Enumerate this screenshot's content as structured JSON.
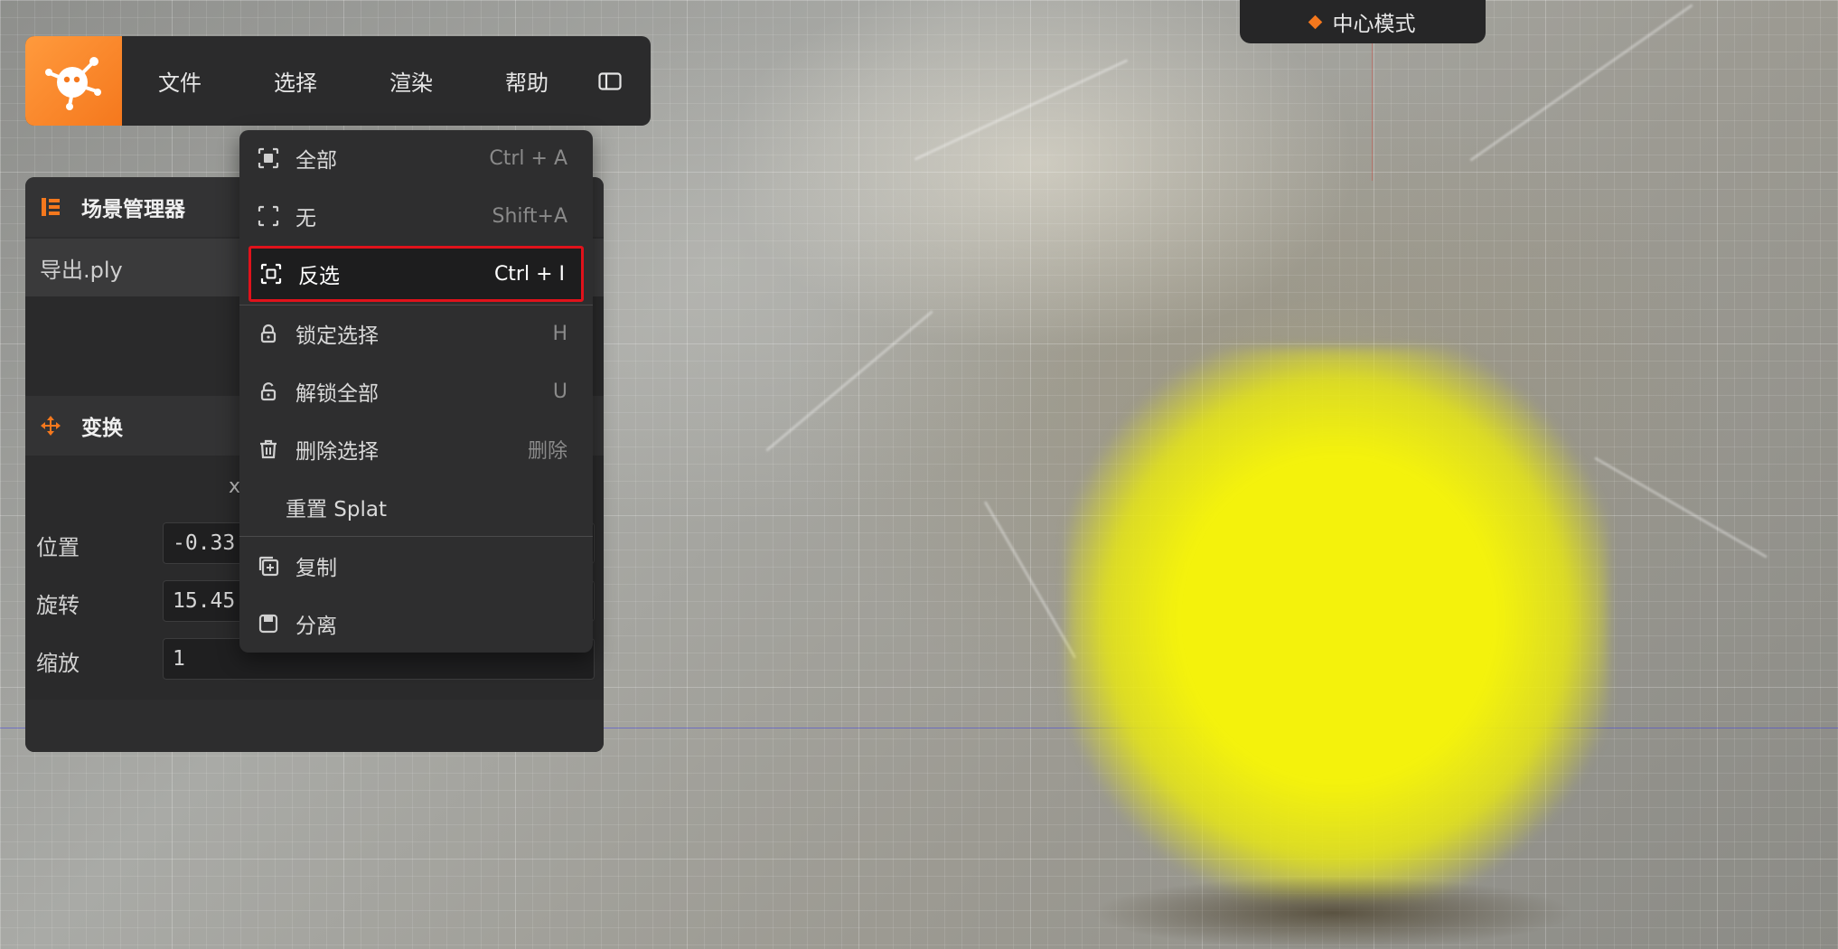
{
  "menubar": {
    "items": [
      "文件",
      "选择",
      "渲染",
      "帮助"
    ]
  },
  "mode_pill": {
    "label": "中心模式",
    "accent": "#f5781d"
  },
  "scene_manager": {
    "title": "场景管理器",
    "items": [
      "导出.ply"
    ]
  },
  "transform": {
    "title": "变换",
    "axis_label": "x",
    "properties": [
      {
        "label": "位置",
        "value": "-0.33"
      },
      {
        "label": "旋转",
        "value": "15.45"
      },
      {
        "label": "缩放",
        "value": "1"
      }
    ]
  },
  "select_menu": {
    "items": [
      {
        "label": "全部",
        "shortcut": "Ctrl + A",
        "icon": "select-all-icon"
      },
      {
        "label": "无",
        "shortcut": "Shift+A",
        "icon": "select-none-icon"
      },
      {
        "label": "反选",
        "shortcut": "Ctrl + I",
        "icon": "invert-selection-icon"
      },
      {
        "label": "锁定选择",
        "shortcut": "H",
        "icon": "lock-icon"
      },
      {
        "label": "解锁全部",
        "shortcut": "U",
        "icon": "unlock-icon"
      },
      {
        "label": "删除选择",
        "shortcut": "删除",
        "icon": "trash-icon"
      },
      {
        "label": "重置 Splat",
        "shortcut": ""
      },
      {
        "label": "复制",
        "shortcut": "",
        "icon": "duplicate-icon"
      },
      {
        "label": "分离",
        "shortcut": "",
        "icon": "separate-icon"
      }
    ],
    "highlight_color": "#e0121b"
  },
  "colors": {
    "brand_orange": "#f5781d",
    "selection_yellow": "#f4f20c"
  }
}
